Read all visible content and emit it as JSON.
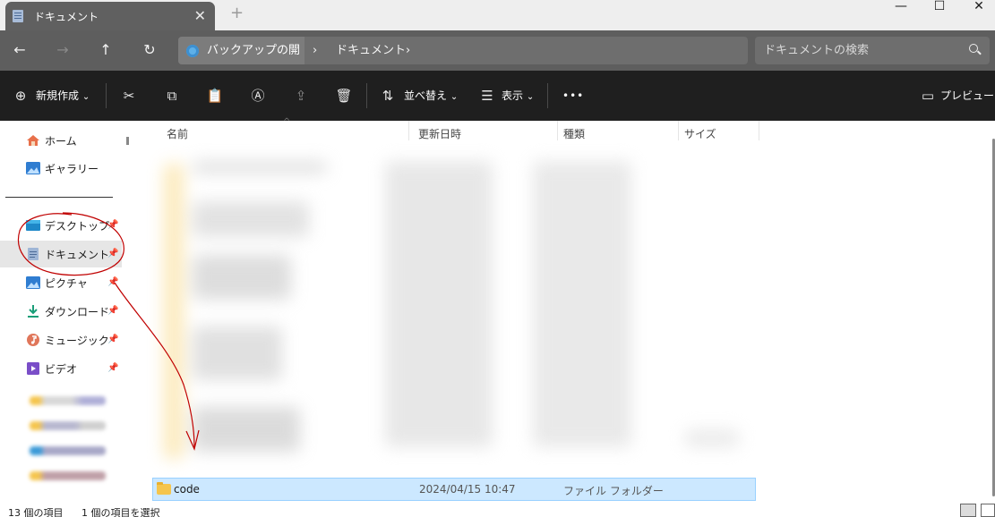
{
  "window": {
    "tab_title": "ドキュメント",
    "tab_close": "✕",
    "new_tab": "+",
    "controls": {
      "minimize": "—",
      "maximize": "☐",
      "close": "✕"
    }
  },
  "nav": {
    "back": "←",
    "forward": "→",
    "up": "↑",
    "refresh": "↻",
    "breadcrumb": [
      "バックアップの開始",
      "ドキュメント"
    ],
    "chevron": "›",
    "search_placeholder": "ドキュメントの検索"
  },
  "toolbar": {
    "new_label": "新規作成",
    "sort_label": "並べ替え",
    "view_label": "表示",
    "more_label": "•••",
    "preview_label": "プレビュー",
    "dropdown": "⌄"
  },
  "sidebar": {
    "home": "ホーム",
    "gallery": "ギャラリー",
    "pinned": [
      "デスクトップ",
      "ドキュメント",
      "ピクチャ",
      "ダウンロード",
      "ミュージック",
      "ビデオ"
    ]
  },
  "columns": {
    "name": "名前",
    "modified": "更新日時",
    "type": "種類",
    "size": "サイズ"
  },
  "selected_row": {
    "name": "code",
    "modified": "2024/04/15 10:47",
    "type": "ファイル フォルダー"
  },
  "status": {
    "item_count": "13 個の項目",
    "selection": "1 個の項目を選択"
  },
  "colors": {
    "accent": "#cce8ff",
    "annotation": "#c00000"
  }
}
